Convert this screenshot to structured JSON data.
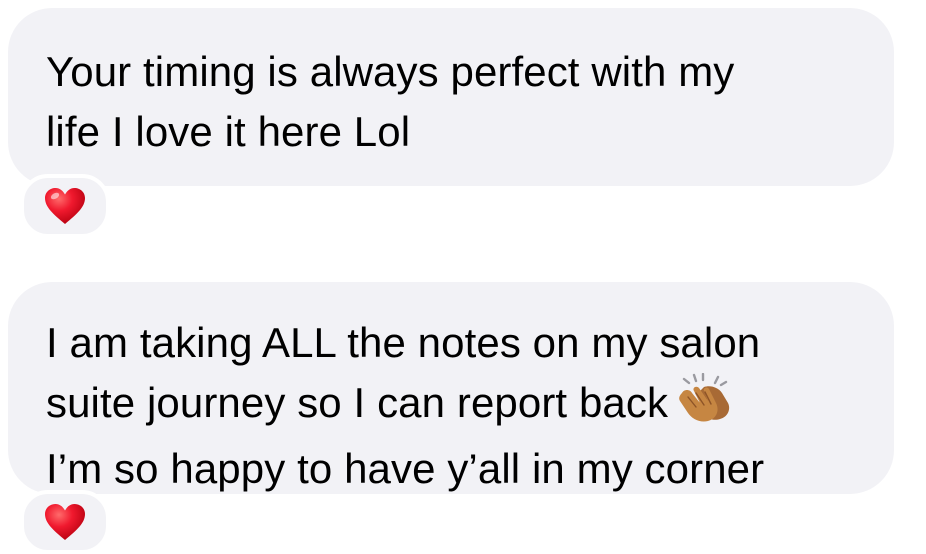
{
  "messages": [
    {
      "lines": [
        "Your timing is always perfect with my",
        "life I love it here Lol"
      ],
      "reaction": "heart-icon"
    },
    {
      "lines": [
        "I am taking ALL the notes on my salon",
        "suite journey so I can report back",
        "I’m so happy to have y’all in my corner"
      ],
      "inline_emoji": "clapping-hands-icon",
      "reaction": "heart-icon"
    }
  ],
  "colors": {
    "bubble_bg": "#f2f2f6",
    "text": "#000000",
    "heart": "#e8162b",
    "clap_skin": "#c68642"
  }
}
